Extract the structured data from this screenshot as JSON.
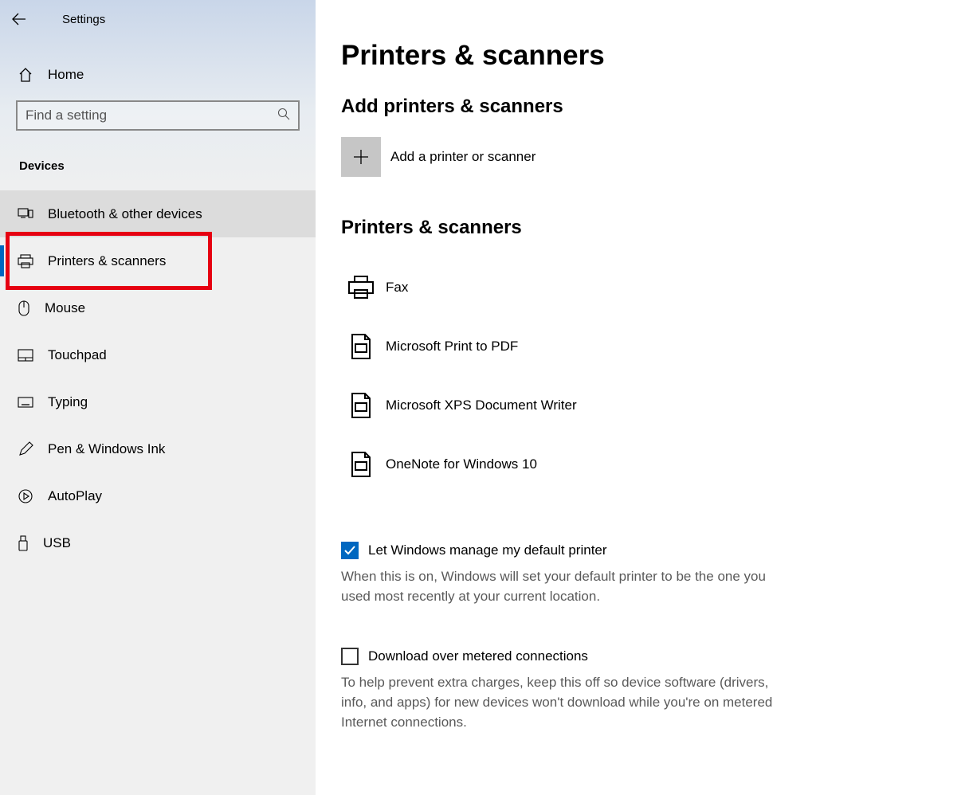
{
  "app_title": "Settings",
  "home_label": "Home",
  "search_placeholder": "Find a setting",
  "group_header": "Devices",
  "nav_items": [
    {
      "label": "Bluetooth & other devices"
    },
    {
      "label": "Printers & scanners"
    },
    {
      "label": "Mouse"
    },
    {
      "label": "Touchpad"
    },
    {
      "label": "Typing"
    },
    {
      "label": "Pen & Windows Ink"
    },
    {
      "label": "AutoPlay"
    },
    {
      "label": "USB"
    }
  ],
  "page_title": "Printers & scanners",
  "add_section": {
    "title": "Add printers & scanners",
    "button_label": "Add a printer or scanner"
  },
  "devices_section": {
    "title": "Printers & scanners",
    "items": [
      {
        "label": "Fax"
      },
      {
        "label": "Microsoft Print to PDF"
      },
      {
        "label": "Microsoft XPS Document Writer"
      },
      {
        "label": "OneNote for Windows 10"
      }
    ]
  },
  "default_printer": {
    "label": "Let Windows manage my default printer",
    "checked": true,
    "desc": "When this is on, Windows will set your default printer to be the one you used most recently at your current location."
  },
  "metered": {
    "label": "Download over metered connections",
    "checked": false,
    "desc": "To help prevent extra charges, keep this off so device software (drivers, info, and apps) for new devices won't download while you're on metered Internet connections."
  }
}
